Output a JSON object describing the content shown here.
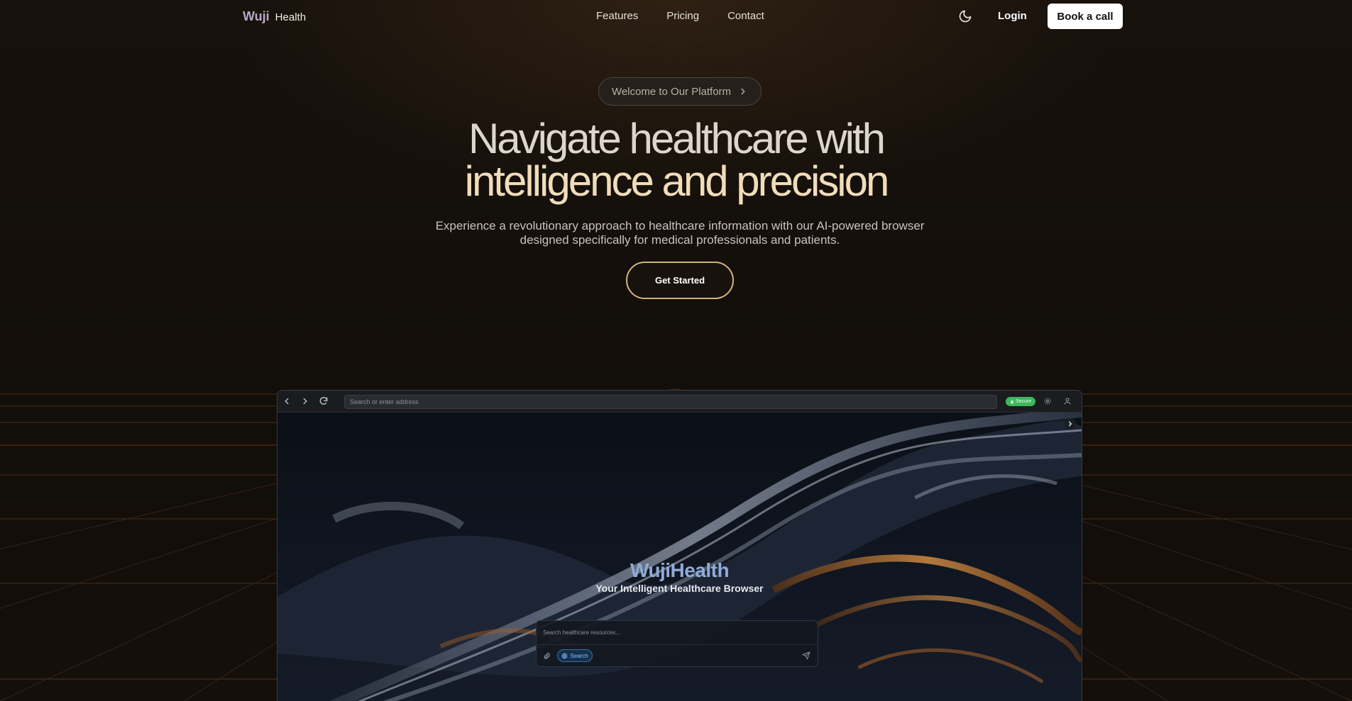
{
  "nav": {
    "logo_main": "Wuji",
    "logo_sub": "Health",
    "links": [
      "Features",
      "Pricing",
      "Contact"
    ],
    "theme_icon": "moon-icon",
    "login": "Login",
    "book_call": "Book a call"
  },
  "hero": {
    "pill_text": "Welcome to Our Platform",
    "headline_line1": "Navigate healthcare with",
    "headline_line2": "intelligence and precision",
    "subtitle_line1": "Experience a revolutionary approach to healthcare information with our AI-powered browser",
    "subtitle_line2": "designed specifically for medical professionals and patients.",
    "cta": "Get Started"
  },
  "browser": {
    "address_placeholder": "Search or enter address",
    "secure_badge": "Secure",
    "brand_title": "WujiHealth",
    "tagline": "Your Intelligent Healthcare Browser",
    "search_placeholder": "Search healthcare resources...",
    "search_chip": "Search"
  },
  "colors": {
    "background": "#140f0b",
    "accent_gold": "#d4b27d",
    "headline_gold": "#f1dcb9",
    "brand_blue": "#8eaad8",
    "secure_green": "#3fb75c"
  }
}
